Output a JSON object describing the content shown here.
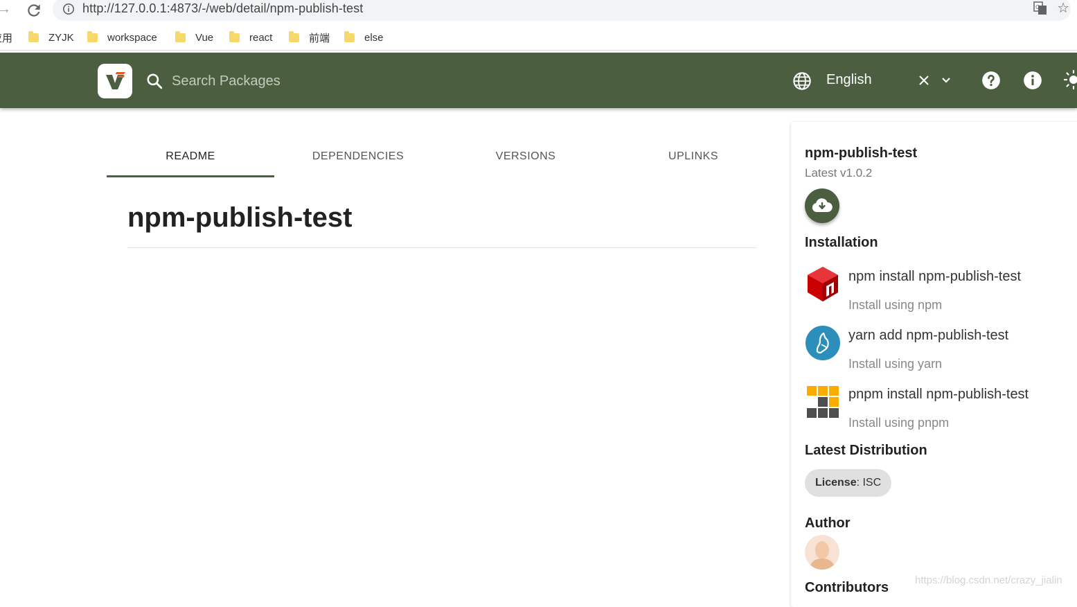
{
  "browser": {
    "url": "http://127.0.0.1:4873/-/web/detail/npm-publish-test",
    "bookmarks_cut_label": "应用",
    "bookmarks": [
      "ZYJK",
      "workspace",
      "Vue",
      "react",
      "前端",
      "else"
    ]
  },
  "header": {
    "search_placeholder": "Search Packages",
    "language": "English"
  },
  "tabs": [
    {
      "label": "README",
      "active": true
    },
    {
      "label": "DEPENDENCIES",
      "active": false
    },
    {
      "label": "VERSIONS",
      "active": false
    },
    {
      "label": "UPLINKS",
      "active": false
    }
  ],
  "readme": {
    "title": "npm-publish-test"
  },
  "sidebar": {
    "package_name": "npm-publish-test",
    "latest": "Latest v1.0.2",
    "installation_title": "Installation",
    "install": [
      {
        "command": "npm install npm-publish-test",
        "subtitle": "Install using npm",
        "icon": "npm-icon"
      },
      {
        "command": "yarn add npm-publish-test",
        "subtitle": "Install using yarn",
        "icon": "yarn-icon"
      },
      {
        "command": "pnpm install npm-publish-test",
        "subtitle": "Install using pnpm",
        "icon": "pnpm-icon"
      }
    ],
    "distribution_title": "Latest Distribution",
    "license_key": "License",
    "license_value": ": ISC",
    "author_title": "Author",
    "contributors_title": "Contributors"
  },
  "watermark": "https://blog.csdn.net/crazy_jialin",
  "colors": {
    "header": "#4b5e40",
    "accent": "#4b5e40",
    "npm": "#cb0000",
    "yarn": "#2c8ebb",
    "pnpm": "#f9ad00"
  }
}
